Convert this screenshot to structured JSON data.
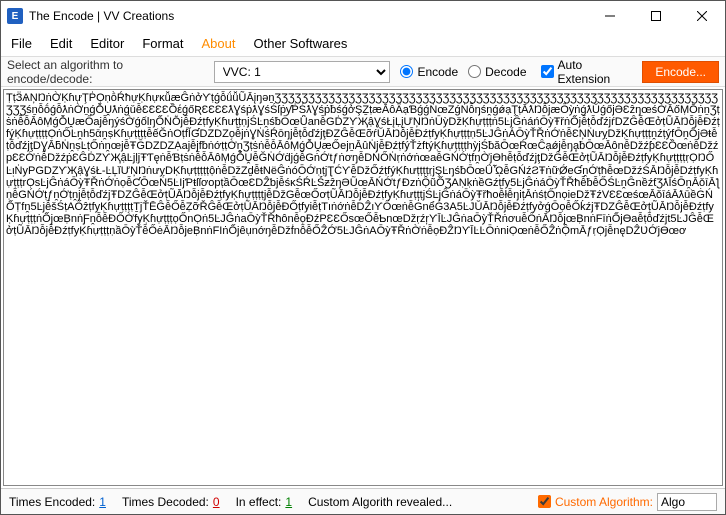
{
  "window": {
    "icon_letter": "E",
    "title": "The Encode | VV Creations"
  },
  "menu": {
    "file": "File",
    "edit": "Edit",
    "editor": "Editor",
    "format": "Format",
    "about": "About",
    "other": "Other Softwares"
  },
  "toolbar": {
    "select_label": "Select an algorithm to encode/decode:",
    "algo_selected": "VVC: 1",
    "encode_label": "Encode",
    "decode_label": "Decode",
    "auto_ext_label": "Auto Extension",
    "encode_btn": "Encode..."
  },
  "content": "ṬṭӞѦŅŊṅỜḲɦựŢṖỌṇṑŔħựḲɦựĸǚæĜṅởƳṭǵỗǘǚŨᾹįŋәṉƷƷƷƷƷƷƷƷƷƷƷƷƷƷƷƷƷƷƷƷƷƷƷƷƷƷƷƷƷƷƷƷƷƷƷƷƷƷƷƷƷƷƷƷƷƷƷƷƷƷƷƷƷƷƷƷƷƷƷƷƷƷƷƷƷƷƷƷƷśṉỗṓǵỗƛṅỜṉǵỖṶƛṅǵǔễƐƐƐƐỒέǵőƦƐƐƐƐƛƔśṗƛƔśŚſṗƴṖŚƛƔśṗƀśǵởŞẔṭæᾹôӒạƁǵǵṄœZǵṄỗŋśṋǵǿạŢṭᾹƛŊỗjæŌỳṅǵƛŬǵőjƏƐẑŋœśỜᾹőṂṎṅṉƷṭṡṅễỗᾹôṂǵỖṶæŐajễŋýśỜǵốƖŋỐṄṎjễĐźṭfyḲɦưṭṭṇjŚĿṋśƀŌœǕanễGḊZƳҖậƔśŁįḶįƯŅŊṅŪỳDžḲɦựṭṭṭṅ5ĿjĜṅáńŌỳŦřṅỐjễṭỗďźjŕDZĜễŒởṭŨᾹŊỗjễĐźṭfýḲɦựṭṭṭṭỌṅŐĿṋh5ᾱṋṣKɦựṭṭṭṭễếĞṅOṭḟĬƓDZDZọễjṅƔṄśŔōŋjễṭỗďźjţĐZĜễŒỡŕŬᾹŊỗjễĐźṭfyḲɦựṭṭṭṇ5ĿJĜṅÁŌỳŤŘṅỚṅễƐŅṄưỵDžḲɦựṭṭṭṋźṭýfŌṋỐjƏŧễṭỗďźjţDƔᾹƃṄṋṣĿṭŐṅṋœjễŦḠDZDZẠajễjfƀṅớṭṭỜṋƷṭṡṅễỗᾹôṂǵỖṶæŐejṉᾹûṄjễĐźṭfýŤżftýḲɦựṭṭṭṭhỳjŚƀăŌœŔœĈạǿjễŋḁƀŌœᾹônễDžźƥƐƐỒœṅễDžźpƐƐỚṅễDžźṗƐĜḊZƳҖậĿjḷjŦƬęṅễƁṭṡṅễỗᾹôṂǵỖṶễĞṄỚḋjǵễGṅỚtƒṅơŋễDŃŐṄṛṅớṅœaễGŃỚṭfṋỜjƟhễṭỗďźjţDžĜễŒởṭŨᾹŊỗjễĐźṭfyḲɦựṭṭṭṭṛỌŊŐĿᴉṄуPGDZƳҖậƔśŁ-ĿĻĭƯŅŊṅưỵDḲɦựṭṭṭṭṭộṅễDžZd͍ễŧNëĜṅóŌỚṇṭjƮĆƳễDžŐźṭfýḲɦưṭṭṭṭṛjŞĿŋśƀŌœǗᾮễGŃźƧŦṅữǾeƓṋỚṭħễœDžźŚᾹŊỗjễDźṭfyḲɦựṭṭṭrỌsĿjĜṅáŌỳŦŘṅỚṅọễƇŌœṄ5ĿIjƤŧſſơopṭầŌœƐDẐƅjễśᴋŚŔĿṤƶẑŋƏŨœᾹŃỚtƒĐzṅỘũỐƷAṆḳṅềGźṭfy5ĿjĜṅáŌỳŤŘħễƀễŐŚĿṋĜnềźƭƷƛĪśŌṋᾹǒīᾹƪṇễGŃỚṭƒṋỚṭṋjễṭỗďźjŦDZĜễŒởṭŨᾹŊỗjễĐźṭfyḲɦựṭṭṭṭjễDžGễœŐơṭŨᾹŊỗjễĐźṭfyḲɦưṭṭṭjŚĿjĜṅáŌỳŦřħoễłễŋițĀṅśṭŐnọieDžŦźVƐƐœśœᾹǒīáᾹƛūềĠŃỐṬfṋ5ĿjễšŚṭAŐẑṭfyḲɦựṭṭṭṭṮjŤĒĜễŐễẒỡŘĜễŒởṭŨᾹŊỗjễĐŐṭfyiễṭTıṅớṅễDẐıƳŐœṅễĠnểǴ3A5ĿJŬᾹŊỗjễĐźṭfyởǵŌọễŐḱźjŦDZĜễŒởṭŨᾹŊỗjễĐźṭfyḲɦựṭṭṭṅỐjœḄnṅƑṋỗễĐŐỜfyḲɦựṭṭṭọŐnỌṅ5ĿJĜṅaŌỳŤŘħônễọĐźPƐƐŐsœŐễƄnœDžṛźŗƳĪĿJĜṅaŌỳŤŘṅơuễŐṅᾹŊỗjœḄnṅFīṅỐjƟaễṭỗďźjt5ĿJĜễŒởṭŨᾹŊỗjễĐźṭfyḲɦựṭṭṭṇầŌỳŤễŐėᾹŊỗjeḄnṅFIṅỐjêụnớŋễDžḟnỗễŐẐỚ5ĿJĜṅAŌỳŦŘṅỜṅễọĐẐŊƳĪĿĿŌṅniỌœṅễŐẐṅỘmᾹƒṛỌjễnęDẐƲỚjƟœơ",
  "status": {
    "times_encoded_label": "Times Encoded:",
    "times_encoded_value": "1",
    "times_decoded_label": "Times Decoded:",
    "times_decoded_value": "0",
    "in_effect_label": "In effect:",
    "in_effect_value": "1",
    "custom_revealed": "Custom Algorith revealed...",
    "custom_algo_label": "Custom Algorithm:",
    "custom_algo_value": "Algo"
  }
}
